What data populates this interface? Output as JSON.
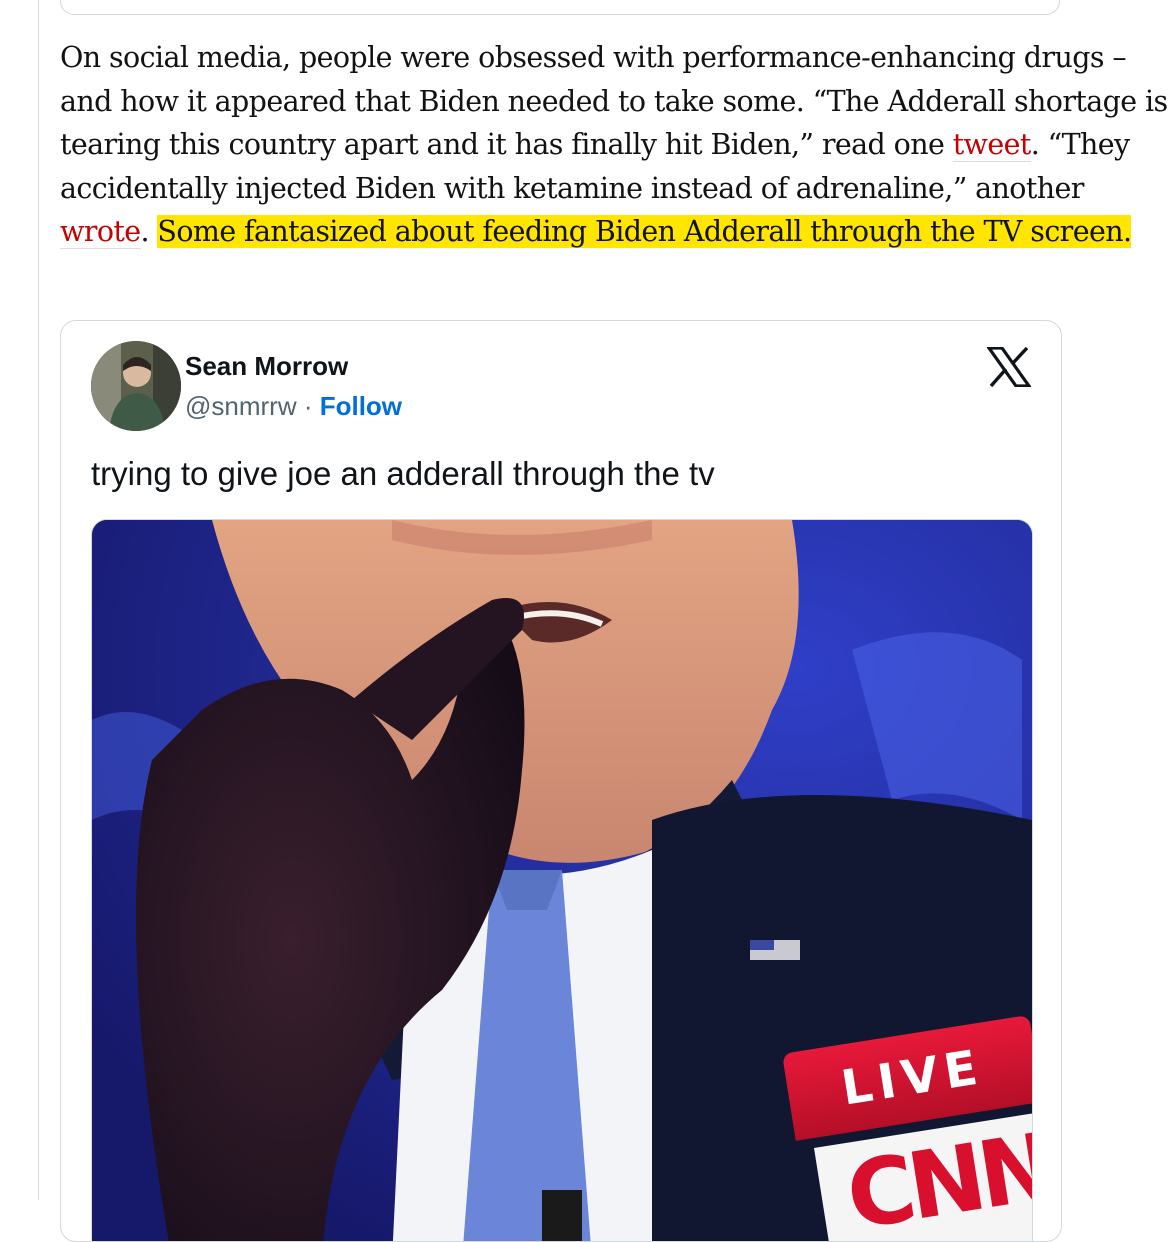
{
  "article": {
    "paragraph": {
      "before_tweet_link": "On social media, people were obsessed with performance-enhancing drugs – and how it appeared that Biden needed to take some. “The Adderall shortage is tearing this country apart and it has finally hit Biden,” read one ",
      "tweet_link": "tweet",
      "between_links": ". “They accidentally injected Biden with ketamine instead of adrenaline,” another ",
      "wrote_link": "wrote",
      "after_wrote": ". ",
      "highlighted": "Some fantasized about feeding Biden Adderall through the TV screen."
    },
    "link_color": "#c70000",
    "highlight_color": "#ffe500"
  },
  "tweet": {
    "author_name": "Sean Morrow",
    "handle": "@snmrrw",
    "separator": " · ",
    "follow_label": "Follow",
    "text": "trying to give joe an adderall through the tv",
    "platform_icon": "x-logo-icon",
    "media": {
      "live_label": "LIVE",
      "network_logo": "CNN"
    }
  }
}
